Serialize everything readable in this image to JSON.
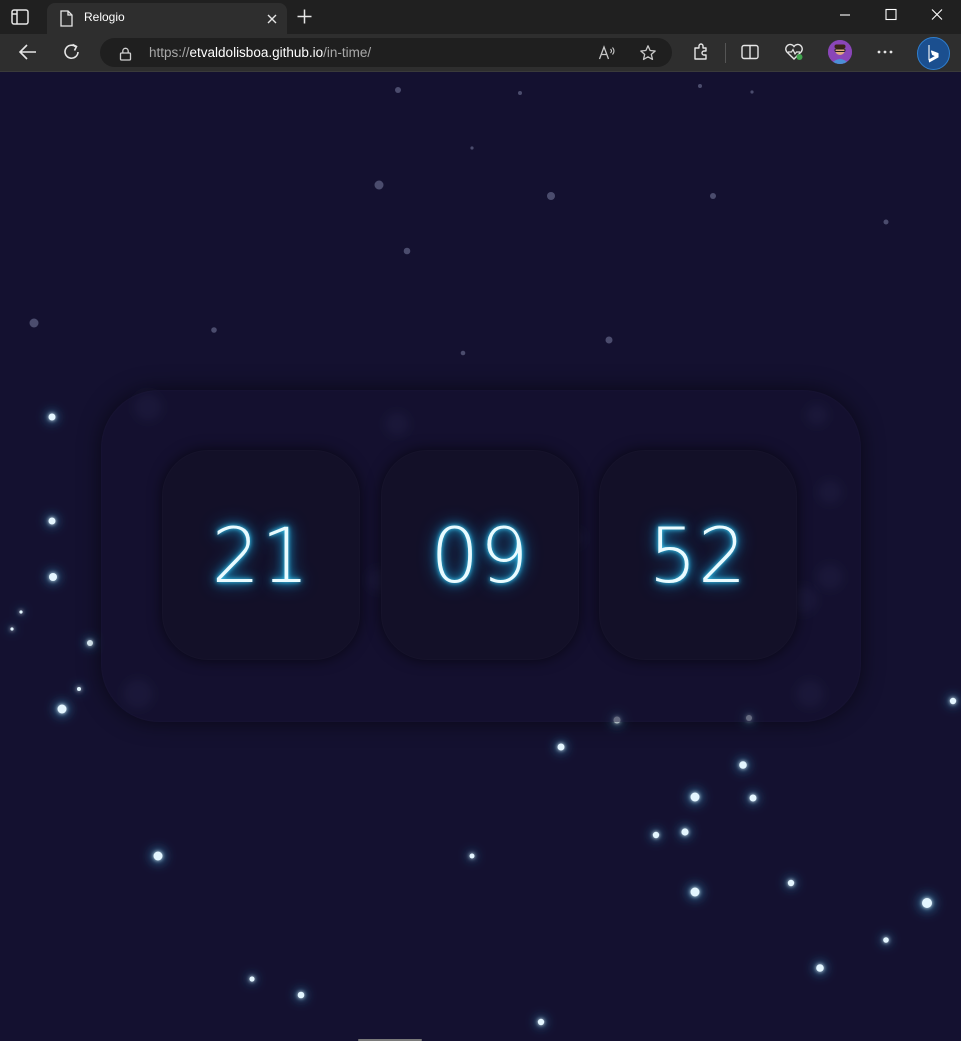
{
  "browser": {
    "tab_title": "Relogio",
    "url_scheme": "https://",
    "url_host": "etvaldolisboa.github.io",
    "url_path": "/in-time/"
  },
  "clock": {
    "hours": "21",
    "minutes": "09",
    "seconds": "52",
    "glow_color": "#3ed6ff",
    "background_color": "#141130"
  }
}
